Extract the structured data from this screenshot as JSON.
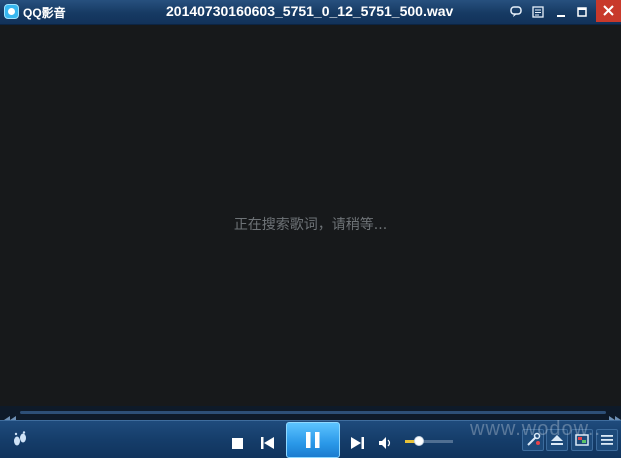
{
  "titlebar": {
    "app_name": "QQ影音",
    "file_name": "20140730160603_5751_0_12_5751_500.wav"
  },
  "lyrics": {
    "status_text": "正在搜索歌词，请稍等..."
  },
  "player": {
    "volume_level": 0.3
  },
  "watermark": {
    "text": "www.wodow.."
  },
  "colors": {
    "title_bar": "#1c4472",
    "video_area": "#17191b",
    "accent_blue": "#2a98e8",
    "close_red": "#c8392b",
    "volume_fill": "#e7c23a"
  },
  "icons": [
    "app-logo-icon",
    "comment-icon",
    "menu-icon",
    "minimize-icon",
    "maximize-icon",
    "close-icon",
    "rewind-icon",
    "fast-forward-icon",
    "footprint-icon",
    "stop-icon",
    "previous-icon",
    "pause-icon",
    "next-icon",
    "volume-icon",
    "tools-icon",
    "eject-icon",
    "image-icon",
    "playlist-icon"
  ]
}
